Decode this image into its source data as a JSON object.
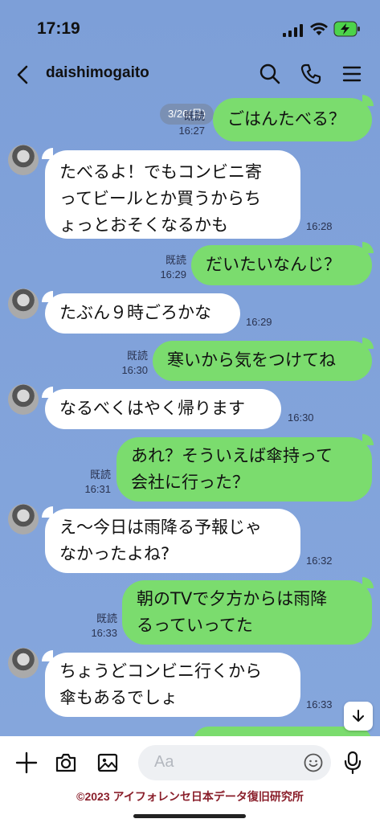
{
  "status": {
    "time": "17:19"
  },
  "header": {
    "title": "daishimogaito"
  },
  "chat": {
    "date": "3/26(日)",
    "messages": [
      {
        "side": "out",
        "text": "ごはんたべる？",
        "time": "16:27",
        "read": "既読"
      },
      {
        "side": "in",
        "text": "たべるよ！でもコンビニ寄\nってビールとか買うからち\nょっとおそくなるかも",
        "time": "16:28"
      },
      {
        "side": "out",
        "text": "だいたいなんじ？",
        "time": "16:29",
        "read": "既読"
      },
      {
        "side": "in",
        "text": "たぶん９時ごろかな",
        "time": "16:29"
      },
      {
        "side": "out",
        "text": "寒いから気をつけてね",
        "time": "16:30",
        "read": "既読"
      },
      {
        "side": "in",
        "text": "なるべくはやく帰ります",
        "time": "16:30"
      },
      {
        "side": "out",
        "text": "あれ？そういえば傘持って\n会社に行った？",
        "time": "16:31",
        "read": "既読"
      },
      {
        "side": "in",
        "text": "え〜今日は雨降る予報じゃ\nなかったよね?",
        "time": "16:32"
      },
      {
        "side": "out",
        "text": "朝のTVで夕方からは雨降\nるっていってた",
        "time": "16:33",
        "read": "既読"
      },
      {
        "side": "in",
        "text": "ちょうどコンビニ行くから\n傘もあるでしょ",
        "time": "16:33"
      }
    ]
  },
  "input": {
    "placeholder": "Aa"
  },
  "footer": {
    "copyright": "©2023 アイフォレンセ日本データ復旧研究所"
  },
  "colors": {
    "background": "#7d9fd8",
    "outgoing": "#7bdc6e",
    "incoming": "#ffffff"
  },
  "icons": [
    "back-icon",
    "search-icon",
    "phone-icon",
    "menu-icon",
    "plus-icon",
    "camera-icon",
    "image-icon",
    "emoji-icon",
    "mic-icon",
    "arrow-down-icon"
  ]
}
